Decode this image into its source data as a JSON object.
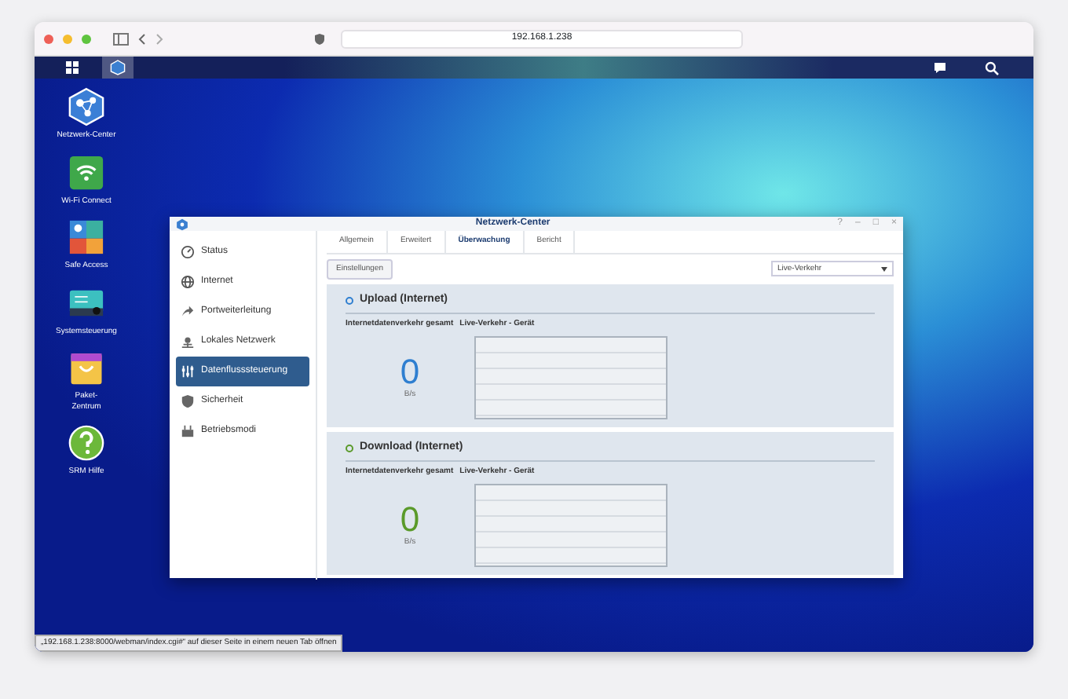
{
  "browser": {
    "url": "192.168.1.238",
    "status_link": "„192.168.1.238:8000/webman/index.cgi#“ auf dieser Seite in einem neuen Tab öffnen"
  },
  "desktop_icons": [
    {
      "kind": "network",
      "label": "Netzwerk-Center"
    },
    {
      "kind": "wifi",
      "label": "Wi-Fi Connect"
    },
    {
      "kind": "safe",
      "label": "Safe Access"
    },
    {
      "kind": "system",
      "label": "Systemsteuerung"
    },
    {
      "kind": "package",
      "label": "Paket-\nZentrum"
    },
    {
      "kind": "help",
      "label": "SRM Hilfe"
    }
  ],
  "window": {
    "title": "Netzwerk-Center",
    "controls": [
      "?",
      "–",
      "□",
      "×"
    ],
    "sidebar": [
      {
        "kind": "status",
        "label": "Status",
        "selected": false
      },
      {
        "kind": "internet",
        "label": "Internet",
        "selected": false
      },
      {
        "kind": "port",
        "label": "Portweiterleitung",
        "selected": false
      },
      {
        "kind": "lan",
        "label": "Lokales Netzwerk",
        "selected": false
      },
      {
        "kind": "flow",
        "label": "Datenflusssteuerung",
        "selected": true
      },
      {
        "kind": "security",
        "label": "Sicherheit",
        "selected": false
      },
      {
        "kind": "mode",
        "label": "Betriebsmodi",
        "selected": false
      }
    ],
    "tabs": [
      {
        "label": "Allgemein",
        "selected": false
      },
      {
        "label": "Erweitert",
        "selected": false
      },
      {
        "label": "Überwachung",
        "selected": true
      },
      {
        "label": "Bericht",
        "selected": false
      }
    ],
    "settings_button": "Einstellungen",
    "view_select": "Live-Verkehr",
    "panels": [
      {
        "title": "Upload (Internet)",
        "color": "#2f7fd0",
        "label_1": "Internetdatenverkehr gesamt",
        "label_2": "Live-Verkehr - Gerät",
        "value": "0",
        "unit": "B/s"
      },
      {
        "title": "Download (Internet)",
        "color": "#5a9a2a",
        "label_1": "Internetdatenverkehr gesamt",
        "label_2": "Live-Verkehr - Gerät",
        "value": "0",
        "unit": "B/s"
      }
    ]
  }
}
